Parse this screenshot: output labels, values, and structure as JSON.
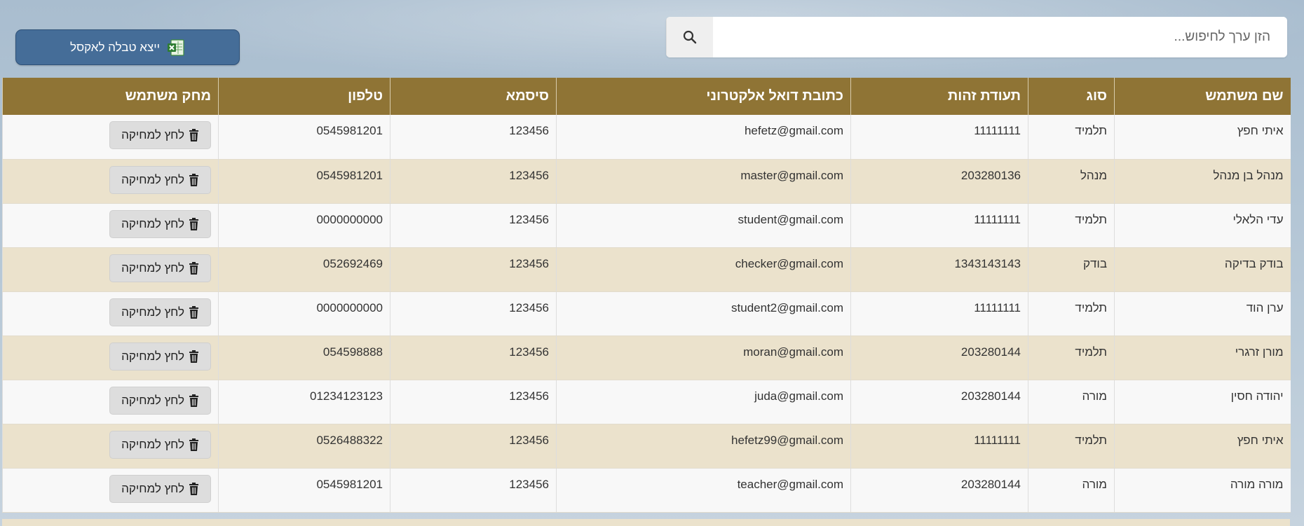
{
  "toolbar": {
    "export_label": "ייצא טבלה לאקסל",
    "export_icon": "excel-icon"
  },
  "search": {
    "placeholder": "הזן ערך לחיפוש...",
    "value": "",
    "icon": "search-icon"
  },
  "table": {
    "headers": {
      "name": "שם משתמש",
      "type": "סוג",
      "id": "תעודת זהות",
      "email": "כתובת דואל אלקטרוני",
      "password": "סיסמא",
      "phone": "טלפון",
      "delete": "מחק משתמש"
    },
    "delete_label": "לחץ למחיקה",
    "rows": [
      {
        "name": "איתי חפץ",
        "type": "תלמיד",
        "id": "11111111",
        "email": "hefetz@gmail.com",
        "password": "123456",
        "phone": "0545981201"
      },
      {
        "name": "מנהל בן מנהל",
        "type": "מנהל",
        "id": "203280136",
        "email": "master@gmail.com",
        "password": "123456",
        "phone": "0545981201"
      },
      {
        "name": "עדי הלאלי",
        "type": "תלמיד",
        "id": "11111111",
        "email": "student@gmail.com",
        "password": "123456",
        "phone": "0000000000"
      },
      {
        "name": "בודק בדיקה",
        "type": "בודק",
        "id": "1343143143",
        "email": "checker@gmail.com",
        "password": "123456",
        "phone": "052692469"
      },
      {
        "name": "ערן הוד",
        "type": "תלמיד",
        "id": "11111111",
        "email": "student2@gmail.com",
        "password": "123456",
        "phone": "0000000000"
      },
      {
        "name": "מורן זרגרי",
        "type": "תלמיד",
        "id": "203280144",
        "email": "moran@gmail.com",
        "password": "123456",
        "phone": "054598888"
      },
      {
        "name": "יהודה חסין",
        "type": "מורה",
        "id": "203280144",
        "email": "juda@gmail.com",
        "password": "123456",
        "phone": "01234123123"
      },
      {
        "name": "איתי חפץ",
        "type": "תלמיד",
        "id": "11111111",
        "email": "hefetz99@gmail.com",
        "password": "123456",
        "phone": "0526488322"
      },
      {
        "name": "מורה מורה",
        "type": "מורה",
        "id": "203280144",
        "email": "teacher@gmail.com",
        "password": "123456",
        "phone": "0545981201"
      }
    ]
  },
  "colors": {
    "header_bg": "#8f7435",
    "row_even": "#ebe2cc",
    "row_odd": "#f8f8f8",
    "link": "#3a7bc0",
    "export_bg": "#456d98"
  }
}
